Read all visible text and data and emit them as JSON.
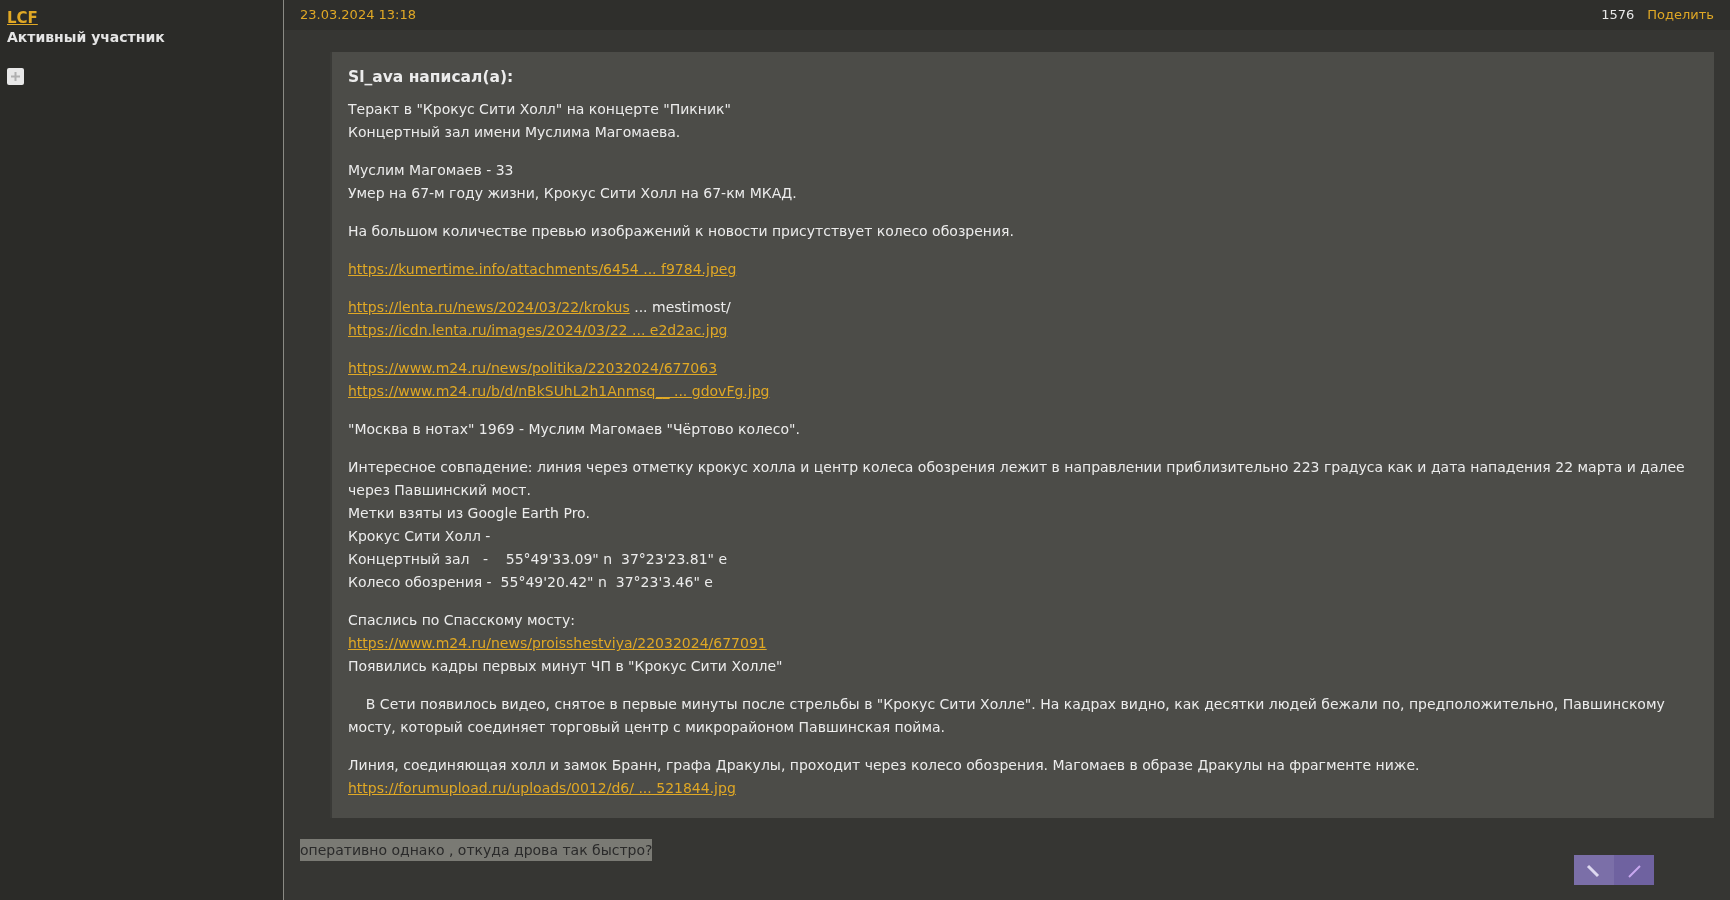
{
  "author": {
    "name": "LCF",
    "rank": "Активный участник"
  },
  "post": {
    "date": "23.03.2024 13:18",
    "number": "1576",
    "share": "Поделить",
    "quote": {
      "title": "Sl_ava написал(а):",
      "paragraphs": [
        {
          "lines": [
            [
              {
                "kind": "text",
                "text": "Теракт в \"Крокус Сити Холл\" на концерте \"Пикник\""
              }
            ],
            [
              {
                "kind": "text",
                "text": "Концертный зал имени Муслима Магомаева."
              }
            ]
          ]
        },
        {
          "lines": [
            [
              {
                "kind": "text",
                "text": "Муслим Магомаев - 33"
              }
            ],
            [
              {
                "kind": "text",
                "text": "Умер на 67-м году жизни, Крокус Сити Холл на 67-км МКАД."
              }
            ]
          ]
        },
        {
          "lines": [
            [
              {
                "kind": "text",
                "text": "На большом количестве превью изображений к новости присутствует колесо обозрения."
              }
            ]
          ]
        },
        {
          "lines": [
            [
              {
                "kind": "link",
                "text": "https://kumertime.info/attachments/6454 ... f9784.jpeg"
              }
            ]
          ]
        },
        {
          "lines": [
            [
              {
                "kind": "link",
                "text": "https://lenta.ru/news/2024/03/22/krokus"
              },
              {
                "kind": "text",
                "text": " ... mestimost/"
              }
            ],
            [
              {
                "kind": "link",
                "text": "https://icdn.lenta.ru/images/2024/03/22 ... e2d2ac.jpg"
              }
            ]
          ]
        },
        {
          "lines": [
            [
              {
                "kind": "link",
                "text": "https://www.m24.ru/news/politika/22032024/677063"
              }
            ],
            [
              {
                "kind": "link",
                "text": "https://www.m24.ru/b/d/nBkSUhL2h1Anmsq__ ... gdovFg.jpg"
              }
            ]
          ]
        },
        {
          "lines": [
            [
              {
                "kind": "text",
                "text": "\"Москва в нотах\" 1969 - Муслим Магомаев \"Чёртово колесо\"."
              }
            ]
          ]
        },
        {
          "lines": [
            [
              {
                "kind": "text",
                "text": "Интересное совпадение: линия через отметку крокус холла и центр колеса обозрения лежит в направлении приблизительно 223 градуса как и дата нападения 22 марта и далее через Павшинский мост."
              }
            ],
            [
              {
                "kind": "text",
                "text": "Метки взяты из Google Earth Pro."
              }
            ],
            [
              {
                "kind": "text",
                "text": "Крокус Сити Холл -"
              }
            ],
            [
              {
                "kind": "text",
                "text": "Концертный зал   -    55°49'33.09\" n  37°23'23.81\" e"
              }
            ],
            [
              {
                "kind": "text",
                "text": "Колесо обозрения -  55°49'20.42\" n  37°23'3.46\" e"
              }
            ]
          ]
        },
        {
          "lines": [
            [
              {
                "kind": "text",
                "text": "Спаслись по Спасскому мосту:"
              }
            ],
            [
              {
                "kind": "link",
                "text": "https://www.m24.ru/news/proisshestviya/22032024/677091"
              }
            ],
            [
              {
                "kind": "text",
                "text": "Появились кадры первых минут ЧП в \"Крокус Сити Холле\""
              }
            ]
          ]
        },
        {
          "lines": [
            [
              {
                "kind": "text",
                "text": "    В Сети появилось видео, снятое в первые минуты после стрельбы в \"Крокус Сити Холле\". На кадрах видно, как десятки людей бежали по, предположительно, Павшинскому мосту, который соединяет торговый центр с микрорайоном Павшинская пойма."
              }
            ]
          ]
        },
        {
          "lines": [
            [
              {
                "kind": "text",
                "text": "Линия, соединяющая холл и замок Бранн, графа Дракулы, проходит через колесо обозрения. Магомаев в образе Дракулы на фрагменте ниже."
              }
            ],
            [
              {
                "kind": "link",
                "text": "https://forumupload.ru/uploads/0012/d6/ ... 521844.jpg"
              }
            ]
          ]
        }
      ]
    },
    "reply": {
      "text": "оперативно однако , откуда дрова так быстро?",
      "selected": true
    }
  }
}
